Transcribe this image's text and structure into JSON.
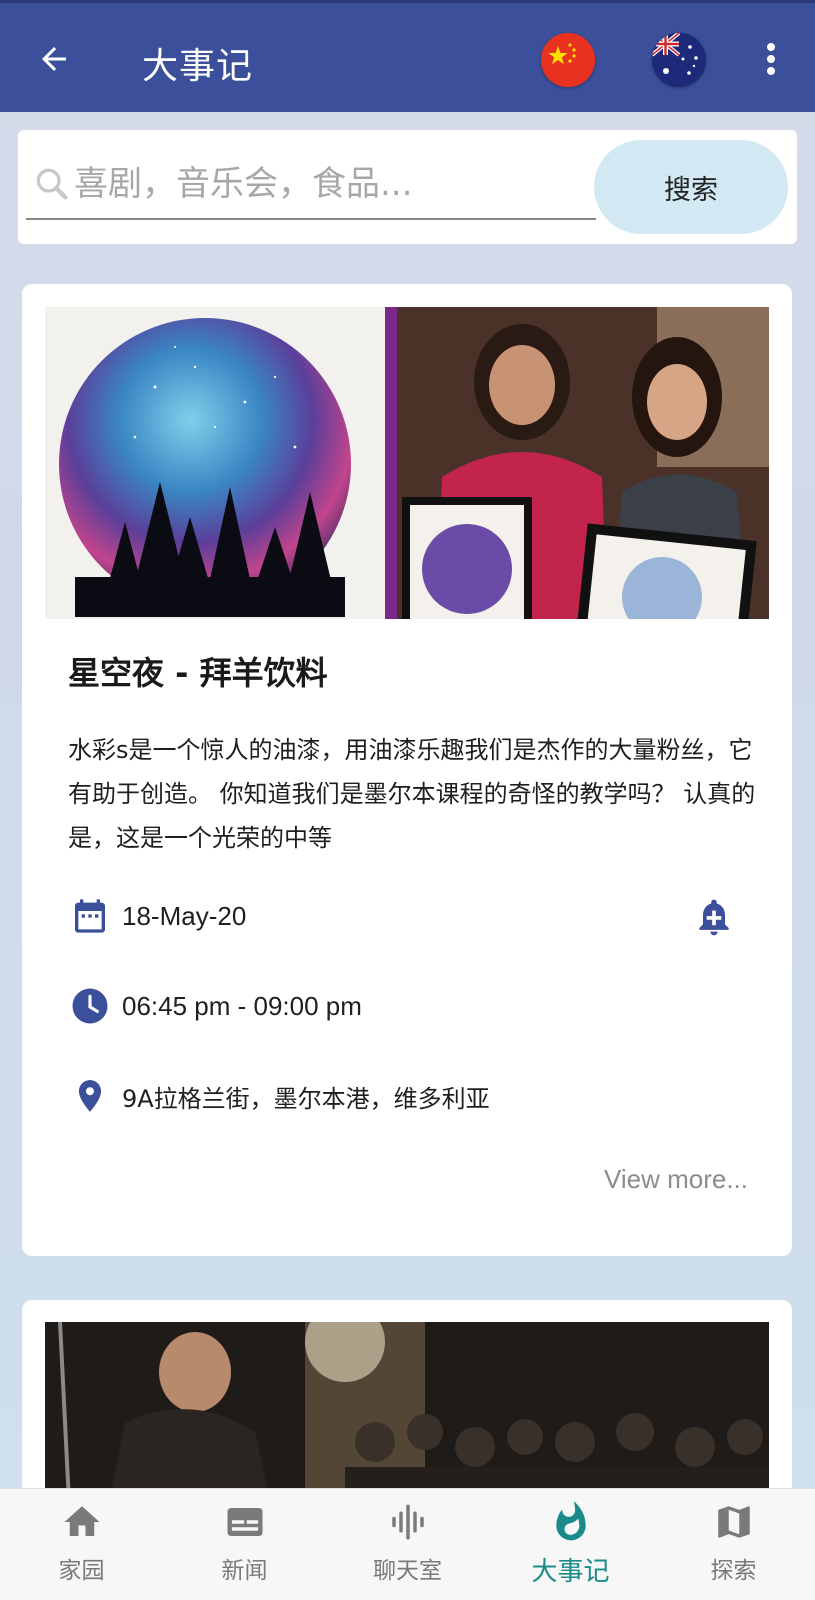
{
  "app_bar": {
    "title": "大事记",
    "icons": [
      "back-arrow-icon",
      "china-flag-icon",
      "australia-flag-icon",
      "more-vert-icon"
    ]
  },
  "search": {
    "placeholder": "喜剧，音乐会，食品...",
    "value": "",
    "button_label": "搜索",
    "icon": "search-icon"
  },
  "events": [
    {
      "title": "星空夜 - 拜羊饮料",
      "description": "水彩s是一个惊人的油漆，用油漆乐趣我们是杰作的大量粉丝，它有助于创造。 你知道我们是墨尔本课程的奇怪的教学吗？ 认真的是，这是一个光荣的中等",
      "date": "18-May-20",
      "time": "06:45 pm - 09:00 pm",
      "location": "9A拉格兰街，墨尔本港，维多利亚",
      "view_more": "View more...",
      "icons": [
        "calendar-icon",
        "clock-icon",
        "location-pin-icon",
        "add-reminder-bell-icon"
      ]
    },
    {
      "title": "",
      "image": "comedy-stage-photo"
    }
  ],
  "bottom_nav": {
    "items": [
      {
        "label": "家园",
        "icon": "home-icon",
        "active": false
      },
      {
        "label": "新闻",
        "icon": "news-icon",
        "active": false
      },
      {
        "label": "聊天室",
        "icon": "audio-wave-icon",
        "active": false
      },
      {
        "label": "大事记",
        "icon": "flame-icon",
        "active": true
      },
      {
        "label": "探索",
        "icon": "map-icon",
        "active": false
      }
    ]
  },
  "colors": {
    "app_bar": "#3c4f9a",
    "accent_teal": "#1b8a8a",
    "icon_blue": "#3c4f9a",
    "search_button": "#d2e8f3"
  }
}
